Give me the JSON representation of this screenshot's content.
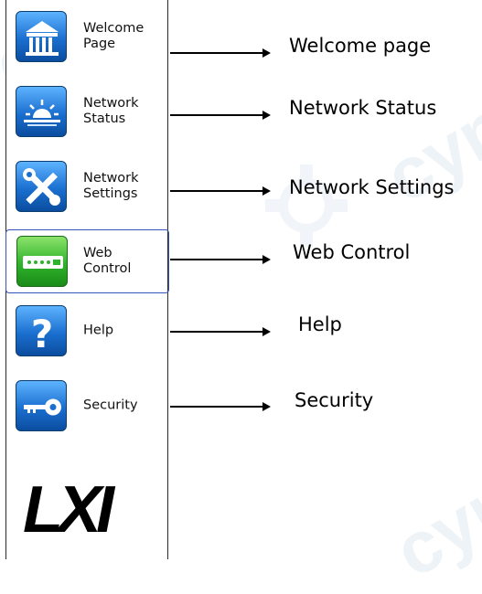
{
  "watermark": {
    "text": "cyn",
    "color": "#eef3f7"
  },
  "menu": {
    "items": [
      {
        "label": "Welcome\nPage",
        "icon": "building-icon",
        "name": "welcome-page"
      },
      {
        "label": "Network\nStatus",
        "icon": "sunrise-icon",
        "name": "network-status"
      },
      {
        "label": "Network\nSettings",
        "icon": "tools-icon",
        "name": "network-settings"
      },
      {
        "label": "Web\nControl",
        "icon": "device-panel-icon",
        "name": "web-control"
      },
      {
        "label": "Help",
        "icon": "question-mark-icon",
        "name": "help"
      },
      {
        "label": "Security",
        "icon": "key-icon",
        "name": "security"
      }
    ],
    "active": "Web Control",
    "logo_text": "LXI"
  },
  "callouts": [
    "Welcome page",
    "Network Status",
    "Network Settings",
    "Web Control",
    "Help",
    "Security"
  ],
  "colors": {
    "icon_blue": "#1b6fd0",
    "icon_green": "#2fb32b",
    "active_border": "#3556b8"
  }
}
